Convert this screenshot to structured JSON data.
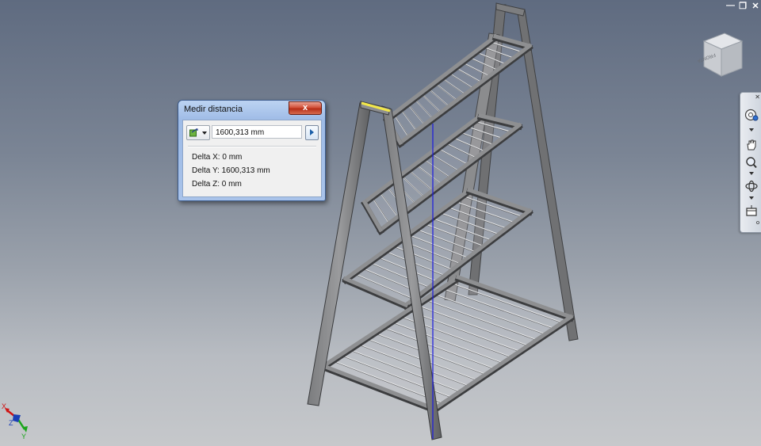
{
  "window_controls": {
    "minimize": "—",
    "restore": "❐",
    "close": "✕"
  },
  "dialog": {
    "title": "Medir distancia",
    "close_label": "x",
    "measure_value": "1600,313 mm",
    "delta_x": "Delta X: 0 mm",
    "delta_y": "Delta Y: 1600,313 mm",
    "delta_z": "Delta Z: 0 mm",
    "tool_icon": "measure-distance-icon"
  },
  "viewcube": {
    "face_label": "FRONTAL"
  },
  "navbar": {
    "tools": [
      "steering-wheel-icon",
      "pan-icon",
      "zoom-icon",
      "orbit-icon",
      "look-at-icon"
    ]
  },
  "triad": {
    "x_label": "X",
    "y_label": "Y",
    "z_label": "Z"
  },
  "colors": {
    "frame": "#5c5d5f",
    "frame_light": "#8a8b8d",
    "measure_line": "#1a1ae0",
    "selected_edge": "#f2e74a",
    "x_axis": "#d01414",
    "y_axis": "#1aa51a",
    "z_axis": "#1a3fb5"
  }
}
